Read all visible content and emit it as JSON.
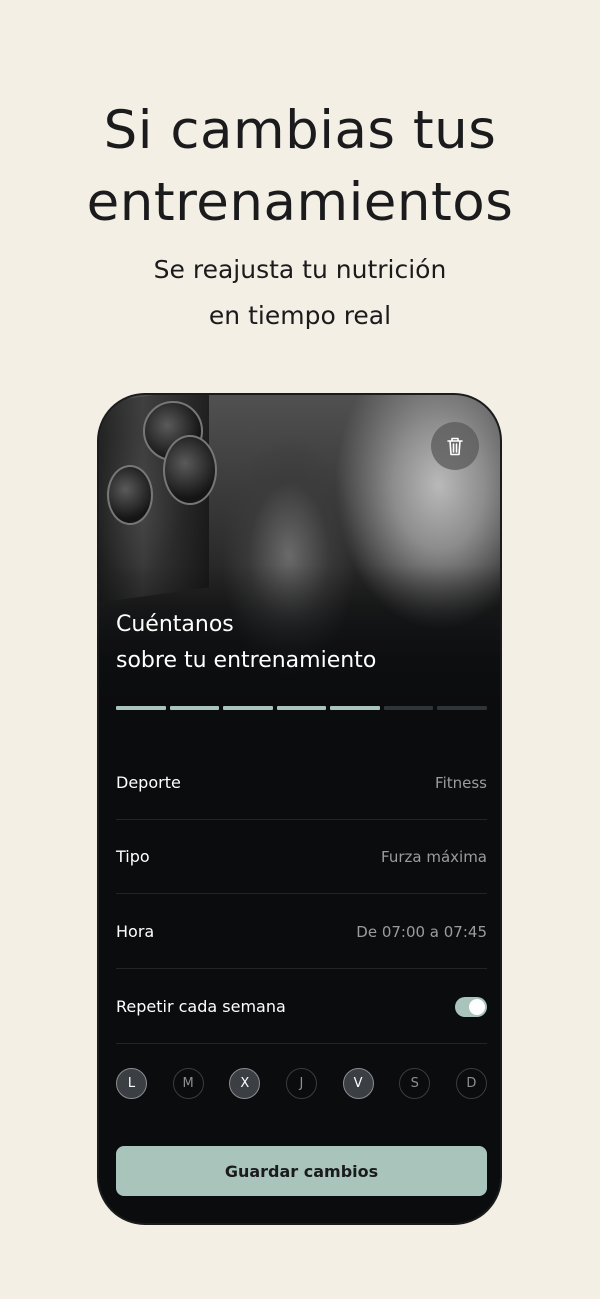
{
  "promo": {
    "title": "Si cambias tus\nentrenamientos",
    "subtitle": "Se reajusta tu nutrición\nen tiempo real"
  },
  "screen": {
    "header_title": "Cuéntanos\nsobre tu entrenamiento",
    "trash_icon": "trash-icon",
    "progress": {
      "filled": 5,
      "total": 7,
      "fill_color": "#a9c4bb",
      "empty_color": "#2e3438"
    },
    "rows": [
      {
        "label": "Deporte",
        "value": "Fitness"
      },
      {
        "label": "Tipo",
        "value": "Furza máxima"
      },
      {
        "label": "Hora",
        "value": "De 07:00 a 07:45"
      }
    ],
    "repeat": {
      "label": "Repetir cada semana",
      "enabled": true
    },
    "days": [
      {
        "label": "L",
        "selected": true
      },
      {
        "label": "M",
        "selected": false
      },
      {
        "label": "X",
        "selected": true
      },
      {
        "label": "J",
        "selected": false
      },
      {
        "label": "V",
        "selected": true
      },
      {
        "label": "S",
        "selected": false
      },
      {
        "label": "D",
        "selected": false
      }
    ],
    "save_label": "Guardar cambios"
  },
  "colors": {
    "background": "#f3efe4",
    "accent": "#a9c4bb",
    "screen_bg": "#0b0c0e"
  }
}
